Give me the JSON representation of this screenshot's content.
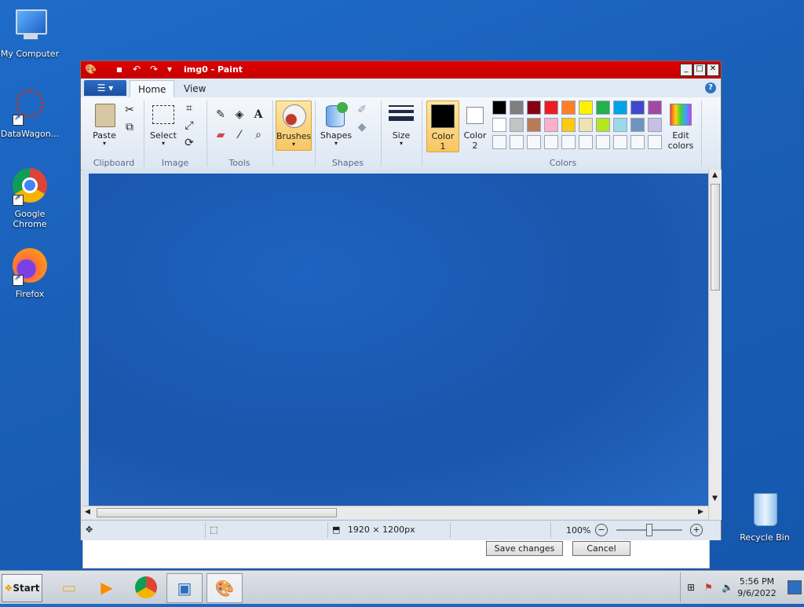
{
  "desktop": {
    "icons": [
      {
        "label": "My Computer"
      },
      {
        "label": "DataWagon..."
      },
      {
        "label": "Google Chrome"
      },
      {
        "label": "Firefox"
      },
      {
        "label": "Recycle Bin"
      }
    ]
  },
  "backdrop_dialog": {
    "save_label": "Save changes",
    "cancel_label": "Cancel"
  },
  "paint": {
    "title": "img0 - Paint",
    "tabs": [
      "Home",
      "View"
    ],
    "groups": {
      "clipboard": "Clipboard",
      "image": "Image",
      "tools": "Tools",
      "shapes": "Shapes",
      "colors": "Colors"
    },
    "buttons": {
      "paste": "Paste",
      "select": "Select",
      "brushes": "Brushes",
      "shapes": "Shapes",
      "size": "Size",
      "color1_line1": "Color",
      "color1_line2": "1",
      "color2_line1": "Color",
      "color2_line2": "2",
      "edit_colors_line1": "Edit",
      "edit_colors_line2": "colors"
    },
    "palette_row1": [
      "#000000",
      "#7f7f7f",
      "#880015",
      "#ed1c24",
      "#ff7f27",
      "#fff200",
      "#22b14c",
      "#00a2e8",
      "#3f48cc",
      "#a349a4"
    ],
    "palette_row2": [
      "#ffffff",
      "#c3c3c3",
      "#b97a57",
      "#ffaec9",
      "#ffc90e",
      "#efe4b0",
      "#b5e61d",
      "#99d9ea",
      "#7092be",
      "#c8bfe7"
    ],
    "color1": "#000000",
    "color2": "#ffffff",
    "status": {
      "dimensions": "1920 × 1200px",
      "zoom": "100%"
    }
  },
  "taskbar": {
    "start_label": "Start",
    "time": "5:56 PM",
    "date": "9/6/2022"
  }
}
